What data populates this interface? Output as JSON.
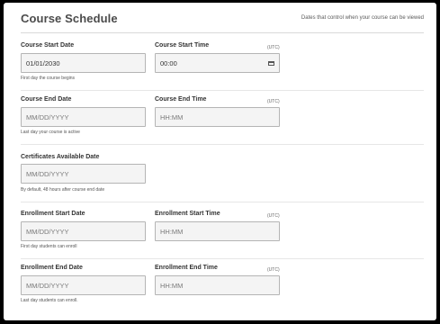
{
  "header": {
    "title": "Course Schedule",
    "description": "Dates that control when your course can be viewed"
  },
  "course_start": {
    "date_label": "Course Start Date",
    "date_value": "01/01/2030",
    "date_help": "First day the course begins",
    "time_label": "Course Start Time",
    "time_utc": "(UTC)",
    "time_value": "00:00"
  },
  "course_end": {
    "date_label": "Course End Date",
    "date_placeholder": "MM/DD/YYYY",
    "date_help": "Last day your course is active",
    "time_label": "Course End Time",
    "time_utc": "(UTC)",
    "time_placeholder": "HH:MM"
  },
  "certificates": {
    "date_label": "Certificates Available Date",
    "date_placeholder": "MM/DD/YYYY",
    "date_help": "By default, 48 hours after course end date"
  },
  "enrollment_start": {
    "date_label": "Enrollment Start Date",
    "date_placeholder": "MM/DD/YYYY",
    "date_help": "First day students can enroll",
    "time_label": "Enrollment Start Time",
    "time_utc": "(UTC)",
    "time_placeholder": "HH:MM"
  },
  "enrollment_end": {
    "date_label": "Enrollment End Date",
    "date_placeholder": "MM/DD/YYYY",
    "date_help": "Last day students can enroll.",
    "time_label": "Enrollment End Time",
    "time_utc": "(UTC)",
    "time_placeholder": "HH:MM"
  }
}
